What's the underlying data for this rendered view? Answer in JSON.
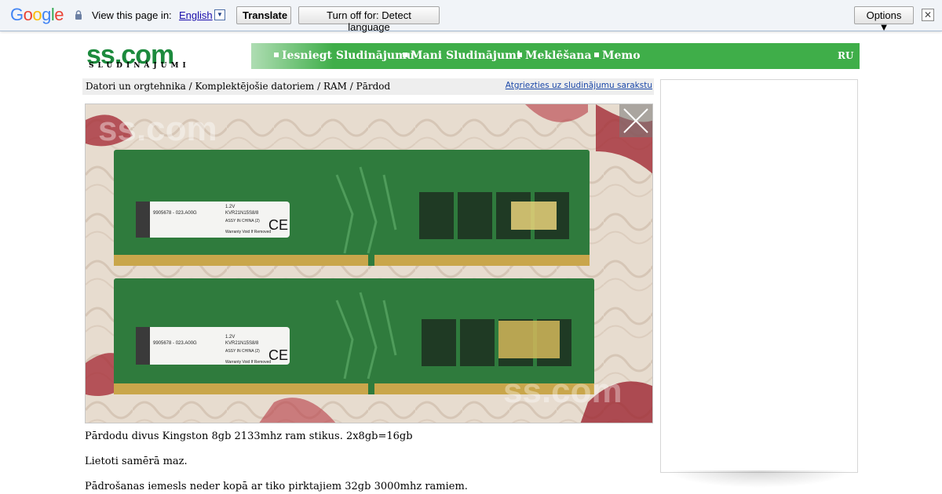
{
  "translate_bar": {
    "logo": "Google",
    "view_text": "View this page in:",
    "language": "English",
    "translate_button": "Translate",
    "turn_off_button": "Turn off for: Detect language",
    "options_button": "Options ▼",
    "close_symbol": "✕"
  },
  "header": {
    "logo": "ss.com",
    "logo_sub": "SLUDINĀJUMI",
    "nav": [
      {
        "label": "Iesniegt Sludinājumu"
      },
      {
        "label": "Mani Sludinājumi"
      },
      {
        "label": "Meklēšana"
      },
      {
        "label": "Memo"
      }
    ],
    "language": "RU",
    "brand_color": "#3fae49"
  },
  "breadcrumb": {
    "path": "Datori un orgtehnika / Komplektējošie datoriem / RAM / Pārdod",
    "back_link": "Atgriezties uz sludinājumu sarakstu"
  },
  "photo": {
    "watermark_top": "ss.com",
    "watermark_bottom": "ss.com",
    "module_label_1": "9905678 - 023.A00G",
    "module_label_2": "KVR21N15S8/8",
    "module_voltage": "1.2V",
    "module_ce": "CE",
    "module_warranty": "Warranty Void If Removed",
    "module_made": "ASSY IN CHINA (2)"
  },
  "description": [
    "Pārdodu divus Kingston 8gb 2133mhz ram stikus. 2x8gb=16gb",
    "Lietoti samērā maz.",
    "Pādrošanas iemesls neder kopā ar tiko pirktajiem 32gb 3000mhz ramiem."
  ]
}
